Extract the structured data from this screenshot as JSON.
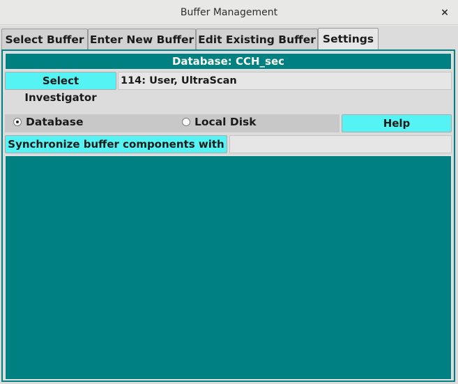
{
  "window": {
    "title": "Buffer Management",
    "close_glyph": "×"
  },
  "tabs": [
    {
      "label": "Select Buffer",
      "active": false
    },
    {
      "label": "Enter New Buffer",
      "active": false
    },
    {
      "label": "Edit Existing Buffer",
      "active": false
    },
    {
      "label": "Settings",
      "active": true
    }
  ],
  "settings": {
    "database_banner": "Database: CCH_sec",
    "select_investigator_label": "Select Investigator",
    "investigator_value": "114: User, UltraScan",
    "source_options": [
      {
        "label": "Database",
        "selected": true
      },
      {
        "label": "Local Disk",
        "selected": false
      }
    ],
    "help_label": "Help",
    "sync_label": "Synchronize buffer components with DB",
    "sync_status": ""
  },
  "colors": {
    "teal": "#008080",
    "cyan_button": "#55f3f3"
  },
  "icons": {
    "close": "close-icon"
  }
}
